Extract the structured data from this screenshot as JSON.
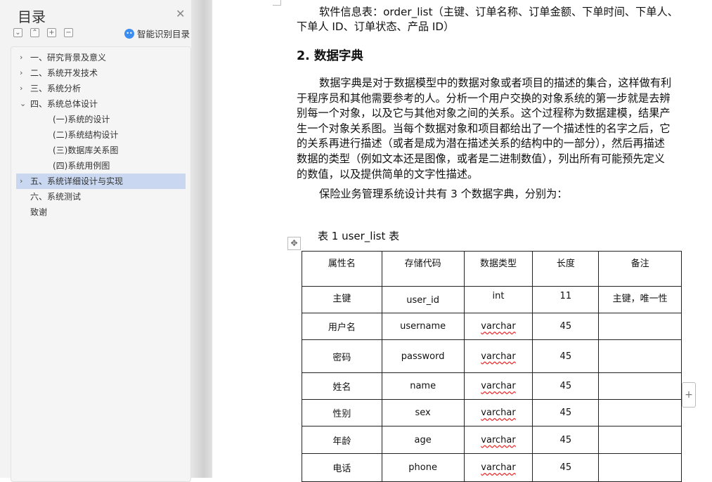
{
  "toc": {
    "title": "目录",
    "smart_label": "智能识别目录",
    "items": [
      {
        "label": "一、研究背景及意义",
        "chevron": "›"
      },
      {
        "label": "二、系统开发技术",
        "chevron": "›"
      },
      {
        "label": "三、系统分析",
        "chevron": "›"
      },
      {
        "label": "四、系统总体设计",
        "chevron": "⌄"
      },
      {
        "label": "(一)系统的设计",
        "chevron": ""
      },
      {
        "label": "(二)系统结构设计",
        "chevron": ""
      },
      {
        "label": "(三)数据库关系图",
        "chevron": ""
      },
      {
        "label": "(四)系统用例图",
        "chevron": ""
      },
      {
        "label": "五、系统详细设计与实现",
        "chevron": "›"
      },
      {
        "label": "六、系统测试",
        "chevron": ""
      },
      {
        "label": "致谢",
        "chevron": ""
      }
    ]
  },
  "doc": {
    "lines_top": [
      "软件信息表：order_list（主键、订单名称、订单金额、下单时间、下单人、",
      "下单人 ID、订单状态、产品 ID）"
    ],
    "heading": "2. 数据字典",
    "para": [
      "数据字典是对于数据模型中的数据对象或者项目的描述的集合，这样做有利",
      "于程序员和其他需要参考的人。分析一个用户交换的对象系统的第一步就是去辨",
      "别每一个对象，以及它与其他对象之间的关系。这个过程称为数据建模，结果产",
      "生一个对象关系图。当每个数据对象和项目都给出了一个描述性的名字之后，它",
      "的关系再进行描述（或者是成为潜在描述关系的结构中的一部分），然后再描述",
      "数据的类型（例如文本还是图像，或者是二进制数值），列出所有可能预先定义",
      "的数值，以及提供简单的文字性描述。"
    ],
    "para2": "保险业务管理系统设计共有 3 个数据字典，分别为：",
    "caption": "表 1  user_list 表",
    "table": {
      "headers": [
        "属性名",
        "存储代码",
        "数据类型",
        "长度",
        "备注"
      ],
      "rows": [
        [
          "主键",
          "user_id",
          "int",
          "11",
          "主键，唯一性"
        ],
        [
          "用户名",
          "username",
          "varchar",
          "45",
          ""
        ],
        [
          "密码",
          "password",
          "varchar",
          "45",
          ""
        ],
        [
          "姓名",
          "name",
          "varchar",
          "45",
          ""
        ],
        [
          "性别",
          "sex",
          "varchar",
          "45",
          ""
        ],
        [
          "年龄",
          "age",
          "varchar",
          "45",
          ""
        ],
        [
          "电话",
          "phone",
          "varchar",
          "45",
          ""
        ]
      ]
    }
  }
}
